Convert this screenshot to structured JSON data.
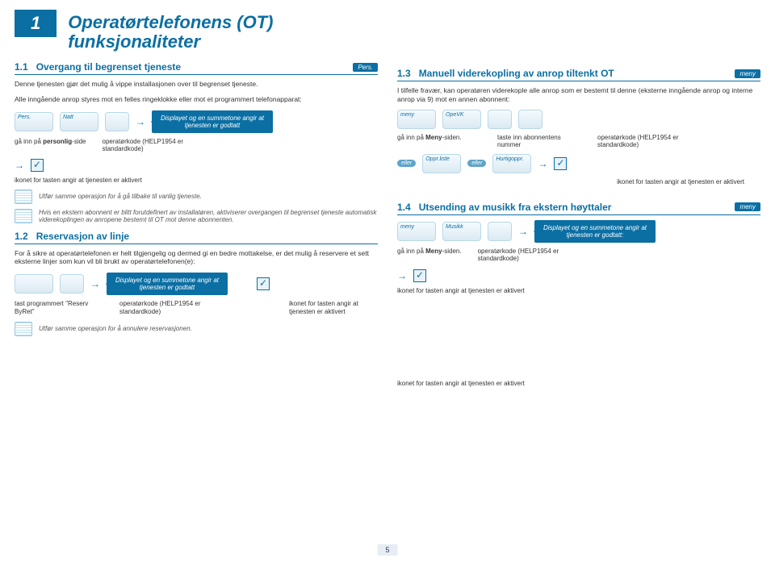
{
  "chapter": {
    "num": "1",
    "title": "Operatørtelefonens (OT) funksjonaliteter"
  },
  "s11": {
    "num": "1.1",
    "title": "Overgang til begrenset tjeneste",
    "tag": "Pers.",
    "intro1": "Denne tjenesten gjør det mulig å vippe installasjonen over til begrenset tjeneste.",
    "intro2": "Alle inngående anrop styres mot en felles ringeklokke eller mot et programmert telefonapparat:",
    "key_pers": "Pers.",
    "key_natt": "Natt",
    "callout1": "Displayet og en summetone angir at tjenesten er godtatt",
    "step_a": "gå inn på personlig-side",
    "step_b": "operatørkode (HELP1954 er standardkode)",
    "activated": "ikonet for tasten angir at tjenesten er aktivert",
    "note_repeat": "Utfør samme operasjon for å gå tilbake til vanlig tjeneste.",
    "note_auto": "Hvis en ekstern abonnent er blitt forutdefinert av installatøren, aktiviserer overgangen til begrenset tjeneste automatisk viderekoplingen av anropene bestemt til OT mot denne abonnenten."
  },
  "s12": {
    "num": "1.2",
    "title": "Reservasjon av linje",
    "intro": "For å sikre at operatørtelefonen er helt tilgjengelig og dermed gi en bedre mottakelse, er det mulig å reservere et sett eksterne linjer som kun vil bli brukt av operatørtelefonen(e):",
    "callout": "Displayet og en summetone angir at tjenesten er godtatt",
    "step_a": "tast programmert \"Reserv ByRet\"",
    "step_b": "operatørkode (HELP1954 er standardkode)",
    "activated": "ikonet for tasten angir at tjenesten er aktivert",
    "note_repeat": "Utfør samme operasjon for å annulere reservasjonen."
  },
  "s13": {
    "num": "1.3",
    "title": "Manuell viderekopling av anrop tiltenkt OT",
    "tag": "meny",
    "intro": "I tilfelle fravær, kan operatøren viderekople alle anrop som er bestemt til denne (eksterne inngående anrop og interne anrop via 9) mot en annen abonnent:",
    "key_meny": "meny",
    "key_opevk": "OpeVK",
    "step_a": "gå inn på Meny-siden.",
    "step_b": "taste inn abonnentens nummer",
    "step_c": "operatørkode (HELP1954 er standardkode)",
    "key_opprliste": "Oppr.liste",
    "key_hurtigoppr": "Hurtigoppr.",
    "eller": "eller",
    "activated": "ikonet for tasten angir at tjenesten er aktivert"
  },
  "s14": {
    "num": "1.4",
    "title": "Utsending av musikk fra ekstern høyttaler",
    "tag": "meny",
    "key_meny": "meny",
    "key_musikk": "Musikk",
    "callout": "Displayet og en summetone angir at tjenesten er godtatt:",
    "step_a": "gå inn på Meny-siden.",
    "step_b": "operatørkode (HELP1954 er standardkode)",
    "activated": "ikonet for tasten angir at tjenesten er aktivert"
  },
  "page_number": "5"
}
